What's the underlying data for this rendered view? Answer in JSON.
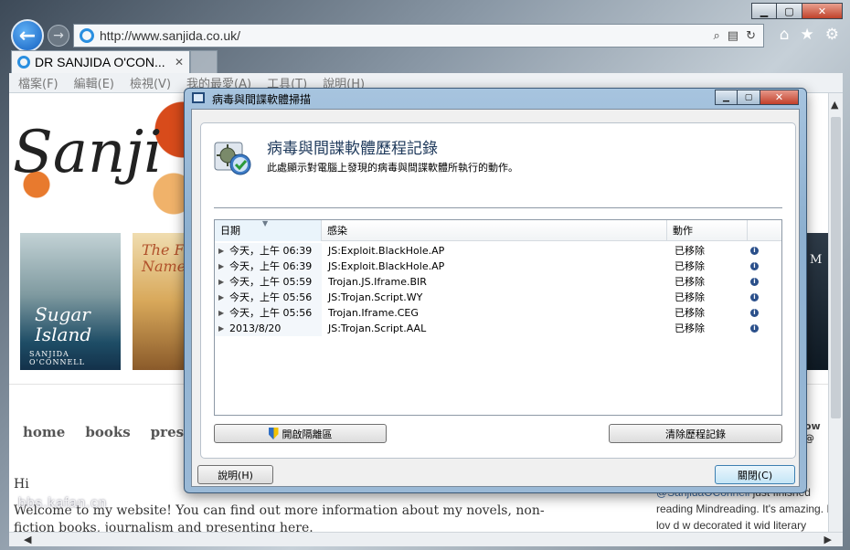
{
  "browser": {
    "address": "http://www.sanjida.co.uk/",
    "tab_title": "DR SANJIDA O'CON...",
    "menu": [
      "檔案(F)",
      "編輯(E)",
      "檢視(V)",
      "我的最愛(A)",
      "工具(T)",
      "說明(H)"
    ]
  },
  "site": {
    "logo_text": "Sanji",
    "book1": {
      "title_line1": "Sugar",
      "title_line2": "Island",
      "author": "SANJIDA O'CONNELL"
    },
    "book2": {
      "title_line1": "The F",
      "title_line2": "Name"
    },
    "book3_letter": "M",
    "nav": [
      "home",
      "books",
      "press"
    ],
    "greeting": "Hi",
    "welcome": "Welcome to my website! You can find out more information about my novels, non-fiction books, journalism and presenting here.",
    "follow": "ow @",
    "tweet_handle": "@SanjidaOConnell",
    "tweet_text": " just finished reading Mindreading. It's amazing. I lov d w decorated it wid literary quotes and",
    "watermark": "bbs.kafan.cn"
  },
  "dialog": {
    "title": "病毒與間諜軟體掃描",
    "heading": "病毒與間諜軟體歷程記錄",
    "description": "此處顯示對電腦上發現的病毒與間諜軟體所執行的動作。",
    "columns": {
      "date": "日期",
      "infection": "感染",
      "action": "動作"
    },
    "rows": [
      {
        "date": "今天，上午 06:39",
        "infection": "JS:Exploit.BlackHole.AP",
        "action": "已移除"
      },
      {
        "date": "今天，上午 06:39",
        "infection": "JS:Exploit.BlackHole.AP",
        "action": "已移除"
      },
      {
        "date": "今天，上午 05:59",
        "infection": "Trojan.JS.Iframe.BIR",
        "action": "已移除"
      },
      {
        "date": "今天，上午 05:56",
        "infection": "JS:Trojan.Script.WY",
        "action": "已移除"
      },
      {
        "date": "今天，上午 05:56",
        "infection": "Trojan.Iframe.CEG",
        "action": "已移除"
      },
      {
        "date": "2013/8/20",
        "infection": "JS:Trojan.Script.AAL",
        "action": "已移除"
      }
    ],
    "buttons": {
      "open_quarantine": "開啟隔離區",
      "clear_history": "清除歷程記錄",
      "help": "說明(H)",
      "close": "關閉(C)"
    },
    "info_glyph": "i"
  }
}
